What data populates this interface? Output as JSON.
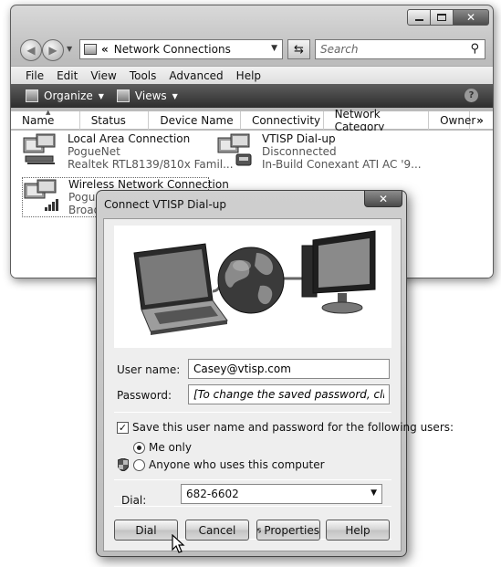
{
  "window": {
    "close_glyph": "✕",
    "address": {
      "separator": "«",
      "text": "Network Connections"
    },
    "search_placeholder": "Search",
    "menu": [
      "File",
      "Edit",
      "View",
      "Tools",
      "Advanced",
      "Help"
    ],
    "toolbar": {
      "organize": "Organize",
      "views": "Views",
      "help": "?"
    },
    "columns": [
      "Name",
      "Status",
      "Device Name",
      "Connectivity",
      "Network Category",
      "Owner",
      "»"
    ],
    "connections": [
      {
        "name": "Local Area Connection",
        "network": "PogueNet",
        "device": "Realtek RTL8139/810x Famil..."
      },
      {
        "name": "VTISP Dial-up",
        "network": "Disconnected",
        "device": "In-Build Conexant ATI AC '9..."
      },
      {
        "name": "Wireless Network Connection",
        "network": "Pogue",
        "device": "Broad"
      }
    ]
  },
  "dialog": {
    "title": "Connect VTISP Dial-up",
    "close_glyph": "✕",
    "user_name_label": "User name:",
    "user_name_value": "Casey@vtisp.com",
    "password_label": "Password:",
    "password_value": "[To change the saved password, click here]",
    "save_checkbox": {
      "label": "Save this user name and password for the following users:",
      "checked": true,
      "mark": "✓"
    },
    "options": [
      {
        "label": "Me only",
        "selected": true
      },
      {
        "label": "Anyone who uses this computer",
        "selected": false
      }
    ],
    "dial_label": "Dial:",
    "dial_value": "682-6602",
    "buttons": {
      "dial": "Dial",
      "cancel": "Cancel",
      "properties": "Properties",
      "help": "Help"
    }
  }
}
